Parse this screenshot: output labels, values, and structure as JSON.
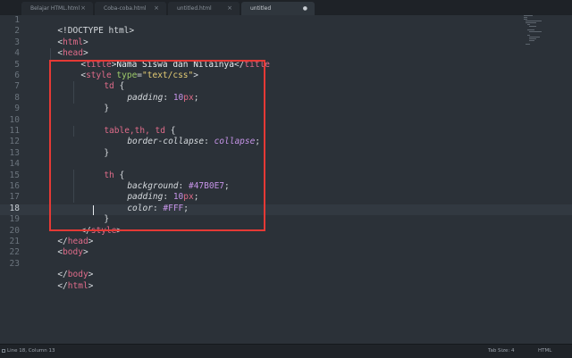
{
  "tabs": [
    {
      "label": "Belajar HTML.html",
      "close": "×",
      "active": false
    },
    {
      "label": "Coba-coba.html",
      "close": "×",
      "active": false
    },
    {
      "label": "untitled.html",
      "close": "×",
      "active": false
    },
    {
      "label": "untitled",
      "close": "●",
      "active": true
    }
  ],
  "gutter": {
    "lines": [
      "1",
      "2",
      "3",
      "4",
      "5",
      "6",
      "7",
      "8",
      "9",
      "10",
      "11",
      "12",
      "13",
      "14",
      "15",
      "16",
      "17",
      "18",
      "19",
      "20",
      "21",
      "22",
      "23"
    ],
    "current": "18"
  },
  "code": {
    "l1_doctype": "<!DOCTYPE html>",
    "l2_open": "<",
    "l2_tag": "html",
    "l2_close": ">",
    "l3_open": "<",
    "l3_tag": "head",
    "l3_close": ">",
    "l4_open": "<",
    "l4_tag": "title",
    "l4_gt": ">",
    "l4_text": "Nama Siswa dan Nilainya",
    "l4_close_open": "</",
    "l4_close_tag": "title",
    "l5_open": "<",
    "l5_tag": "style",
    "l5_attr": "type",
    "l5_eq": "=",
    "l5_val": "\"text/css\"",
    "l5_close": ">",
    "l6_sel": "td",
    "l6_brace": " {",
    "l7_prop": "padding",
    "l7_colon": ": ",
    "l7_num": "10",
    "l7_unit": "px",
    "l7_semi": ";",
    "l8_brace": "}",
    "l10_sel": "table,th, td",
    "l10_brace": " {",
    "l11_prop": "border-collapse",
    "l11_colon": ": ",
    "l11_val": "collapse",
    "l11_semi": ";",
    "l12_brace": "}",
    "l14_sel": "th",
    "l14_brace": " {",
    "l15_prop": "background",
    "l15_colon": ": ",
    "l15_val": "#47B0E7",
    "l15_semi": ";",
    "l16_prop": "padding",
    "l16_colon": ": ",
    "l16_num": "10",
    "l16_unit": "px",
    "l16_semi": ";",
    "l17_prop": "color",
    "l17_colon": ": ",
    "l17_val": "#FFF",
    "l17_semi": ";",
    "l18_brace": "}",
    "l19_open": "</",
    "l19_tag": "style",
    "l19_close": ">",
    "l20_open": "</",
    "l20_tag": "head",
    "l20_close": ">",
    "l21_open": "<",
    "l21_tag": "body",
    "l21_close": ">",
    "l23_open": "</",
    "l23_tag": "body",
    "l23_close": ">",
    "l24_open": "</",
    "l24_tag": "html",
    "l24_close": ">"
  },
  "status": {
    "position": "Line 18, Column 13",
    "tab_size": "Tab Size: 4",
    "syntax": "HTML"
  },
  "colors": {
    "background": "#2b3138",
    "tag": "#e06c8a",
    "attribute": "#9ecb6a",
    "string": "#e4cc74",
    "number": "#c694e8",
    "highlight_box": "#e53935"
  }
}
